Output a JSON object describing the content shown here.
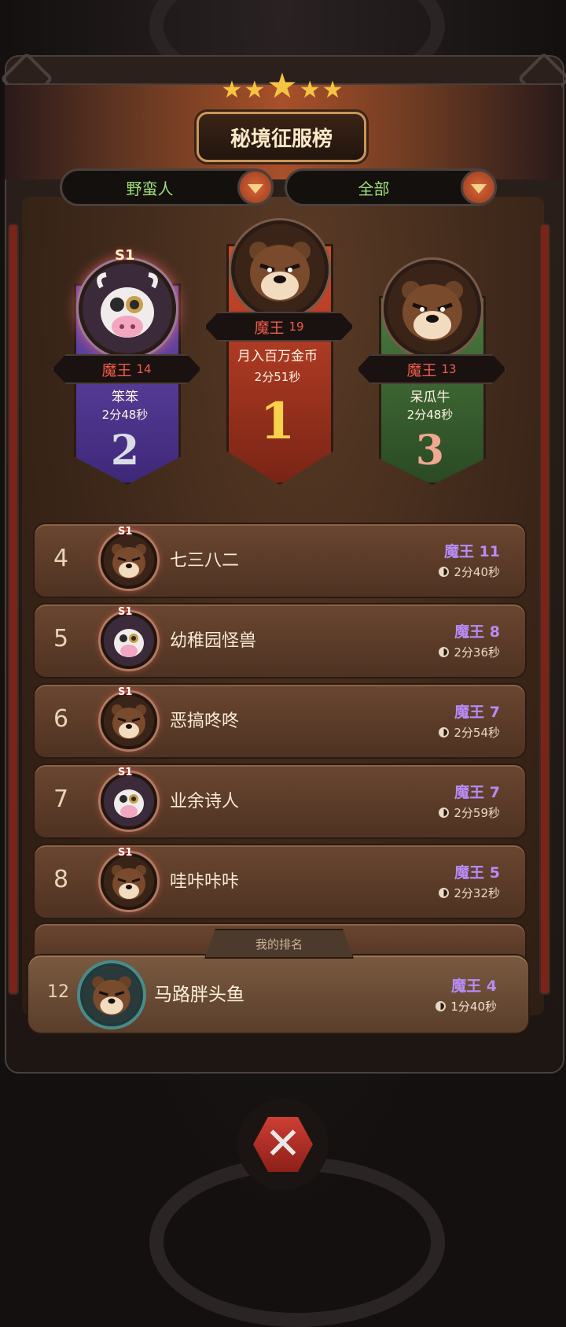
{
  "header": {
    "title": "秘境征服榜",
    "stars": "★★★★★"
  },
  "filters": {
    "class_selected": "野蛮人",
    "scope_selected": "全部"
  },
  "podium": [
    {
      "rank_number": "2",
      "badge": "S1",
      "boss_label": "魔王",
      "boss_level": "14",
      "name": "笨笨",
      "time": "2分48秒",
      "avatar": "cow-avatar-icon"
    },
    {
      "rank_number": "1",
      "badge": "",
      "boss_label": "魔王",
      "boss_level": "19",
      "name": "月入百万金币",
      "time": "2分51秒",
      "avatar": "bear-avatar-icon"
    },
    {
      "rank_number": "3",
      "badge": "",
      "boss_label": "魔王",
      "boss_level": "13",
      "name": "呆瓜牛",
      "time": "2分48秒",
      "avatar": "bear-avatar-icon"
    }
  ],
  "rows": [
    {
      "rank": "4",
      "badge": "S1",
      "name": "七三八二",
      "boss": "魔王 11",
      "time": "2分40秒",
      "avatar": "bear-avatar-icon"
    },
    {
      "rank": "5",
      "badge": "S1",
      "name": "幼稚园怪兽",
      "boss": "魔王 8",
      "time": "2分36秒",
      "avatar": "cow-avatar-icon"
    },
    {
      "rank": "6",
      "badge": "S1",
      "name": "恶搞咚咚",
      "boss": "魔王 7",
      "time": "2分54秒",
      "avatar": "bear-avatar-icon"
    },
    {
      "rank": "7",
      "badge": "S1",
      "name": "业余诗人",
      "boss": "魔王 7",
      "time": "2分59秒",
      "avatar": "cow-avatar-icon"
    },
    {
      "rank": "8",
      "badge": "S1",
      "name": "哇咔咔咔",
      "boss": "魔王 5",
      "time": "2分32秒",
      "avatar": "bear-avatar-icon"
    }
  ],
  "my_rank": {
    "tab_label": "我的排名",
    "rank": "12",
    "name": "马路胖头鱼",
    "boss": "魔王 4",
    "time": "1分40秒",
    "avatar": "bear-avatar-icon"
  },
  "colors": {
    "gold": "#f5c542",
    "boss_purple": "#b78cf5",
    "boss_red": "#f05c4a",
    "filter_green": "#9ee07a",
    "rank1_red": "#b03a22",
    "rank2_purple": "#5a3c9a",
    "rank3_green": "#3c6a34"
  }
}
